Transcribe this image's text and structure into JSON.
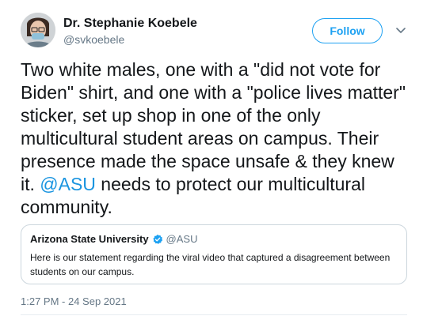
{
  "author": {
    "name": "Dr. Stephanie Koebele",
    "handle": "@svkoebele"
  },
  "follow_label": "Follow",
  "tweet": {
    "text_part1": "Two white males, one with a \"did not vote for Biden\" shirt, and one with a \"police lives matter\" sticker, set up shop in one of the only multicultural student areas on campus. Their presence made the space unsafe & they knew it. ",
    "mention": "@ASU",
    "text_part2": " needs to protect our multicultural community."
  },
  "quoted_tweet": {
    "name": "Arizona State University",
    "handle": "@ASU",
    "verified_icon": "verified-badge-icon",
    "text": "Here is our statement regarding the viral video that captured a disagreement between students on our campus."
  },
  "timestamp": "1:27 PM - 24 Sep 2021",
  "colors": {
    "accent": "#1da1f2",
    "mention": "#1b95e0",
    "secondary_text": "#657786",
    "border": "#ccd6dd"
  }
}
